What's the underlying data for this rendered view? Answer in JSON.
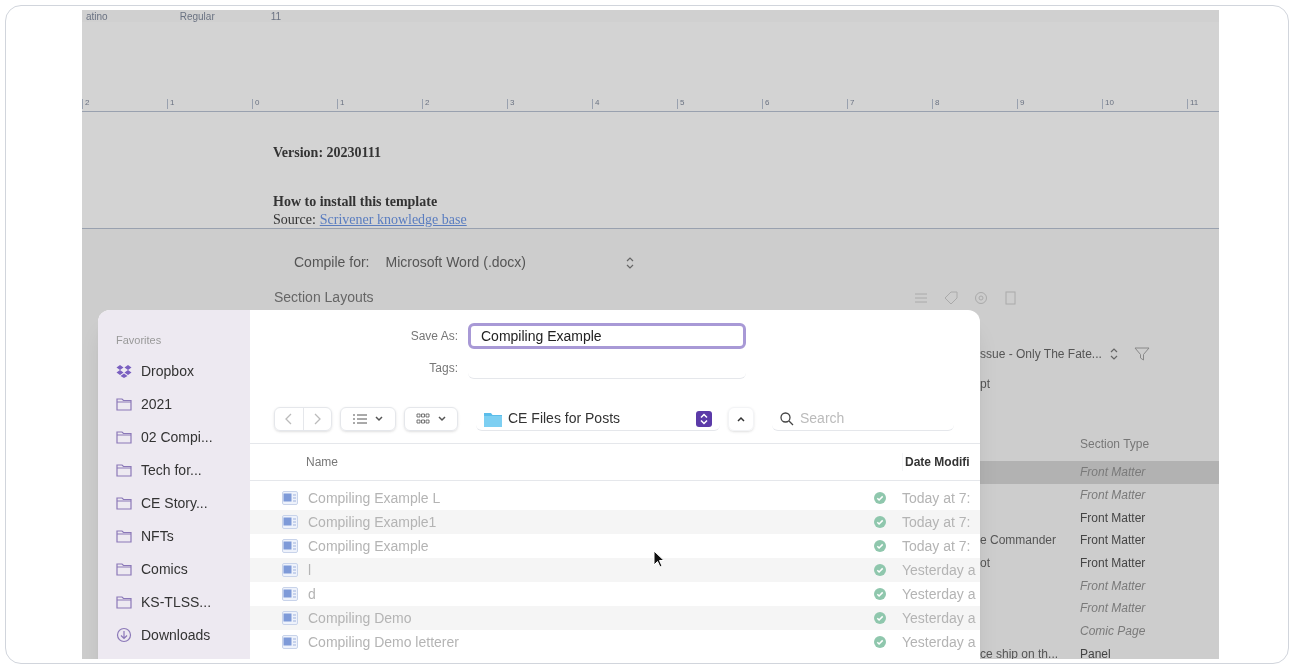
{
  "toolbar": {
    "font": "atino",
    "style": "Regular",
    "size": "11"
  },
  "ruler": {
    "labels": [
      "2",
      "1",
      "0",
      "1",
      "2",
      "3",
      "4",
      "5",
      "6",
      "7",
      "8",
      "9",
      "10",
      "11"
    ]
  },
  "document": {
    "version": "Version: 20230111",
    "heading": "How to install this template",
    "source_label": "Source:",
    "source_link": "Scrivener knowledge base"
  },
  "compile": {
    "label": "Compile for:",
    "format": "Microsoft Word (.docx)",
    "section_layouts": "Section Layouts",
    "project": "ssue - Only The Fate...",
    "column_fragment": "pt",
    "section_type_header": "Section Type",
    "rows": [
      {
        "type": "Front Matter",
        "excluded": true,
        "selected": true
      },
      {
        "type": "Front Matter",
        "excluded": true,
        "selected": false
      },
      {
        "type": "Front Matter",
        "excluded": false,
        "selected": false
      },
      {
        "title": "e Commander",
        "type": "Front Matter",
        "excluded": false,
        "selected": false
      },
      {
        "title": "ot",
        "type": "Front Matter",
        "excluded": false,
        "selected": false
      },
      {
        "type": "Front Matter",
        "excluded": true,
        "selected": false
      },
      {
        "type": "Front Matter",
        "excluded": true,
        "selected": false
      },
      {
        "type": "Comic Page",
        "excluded": true,
        "selected": false
      },
      {
        "title": "ce ship on th...",
        "type": "Panel",
        "excluded": false,
        "selected": false
      }
    ]
  },
  "save_dialog": {
    "sidebar": {
      "heading": "Favorites",
      "items": [
        {
          "label": "Dropbox",
          "kind": "dropbox"
        },
        {
          "label": "2021",
          "kind": "folder"
        },
        {
          "label": "02 Compi...",
          "kind": "folder"
        },
        {
          "label": "Tech for...",
          "kind": "folder"
        },
        {
          "label": "CE Story...",
          "kind": "folder"
        },
        {
          "label": "NFTs",
          "kind": "folder"
        },
        {
          "label": "Comics",
          "kind": "folder"
        },
        {
          "label": "KS-TLSS...",
          "kind": "folder"
        },
        {
          "label": "Downloads",
          "kind": "download"
        }
      ]
    },
    "save_as_label": "Save As:",
    "save_as_value": "Compiling Example",
    "tags_label": "Tags:",
    "location": "CE Files for Posts",
    "search": {
      "placeholder": "Search"
    },
    "columns": [
      "Name",
      "Date Modifi"
    ],
    "files": [
      {
        "name": "Compiling Example L",
        "date": "Today at 7:",
        "disabled": true
      },
      {
        "name": "Compiling Example1",
        "date": "Today at 7:",
        "disabled": true
      },
      {
        "name": "Compiling Example",
        "date": "Today at 7:",
        "disabled": true
      },
      {
        "name": "l",
        "date": "Yesterday a",
        "disabled": true
      },
      {
        "name": "d",
        "date": "Yesterday a",
        "disabled": true
      },
      {
        "name": "Compiling Demo",
        "date": "Yesterday a",
        "disabled": true
      },
      {
        "name": "Compiling Demo letterer",
        "date": "Yesterday a",
        "disabled": true
      }
    ]
  }
}
